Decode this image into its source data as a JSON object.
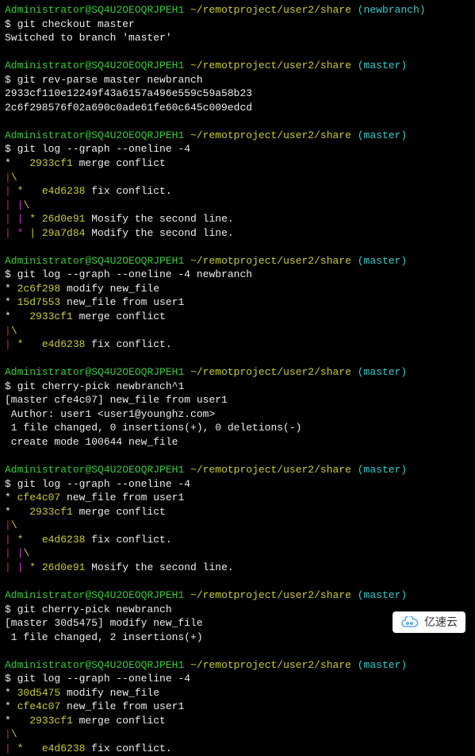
{
  "prompt": {
    "user": "Administrator",
    "host": "SQ4U2OEOQRJPEH1",
    "path": "~/remotproject/user2/share",
    "branch_new": "(newbranch)",
    "branch_master": "(master)"
  },
  "blocks": [
    {
      "branch": "(newbranch)",
      "cmd": "git checkout master",
      "out": [
        "Switched to branch 'master'"
      ]
    },
    {
      "branch": "(master)",
      "cmd": "git rev-parse master newbranch",
      "out": [
        "2933cf110e12249f43a6157a496e559c59a58b23",
        "2c6f298576f02a690c0ade61fe60c645c009edcd"
      ]
    }
  ],
  "log1": {
    "cmd": "git log --graph --oneline -4",
    "lines": [
      {
        "graph_w": "*   ",
        "graph_y": "",
        "hash": "2933cf1",
        "msg": " merge conflict"
      },
      {
        "graph_w": "",
        "graph_r": "|",
        "graph_y": "\\",
        "hash": "",
        "msg": ""
      },
      {
        "graph_w": "",
        "graph_r": "| ",
        "graph_y": "* ",
        "hash": "e4d6238",
        "msg": " fix conflict."
      },
      {
        "graph_w": "",
        "graph_r": "| ",
        "graph_m": "|",
        "graph_y": "\\",
        "hash": "",
        "msg": ""
      },
      {
        "graph_w": "",
        "graph_r": "| ",
        "graph_m": "| ",
        "graph_y": "* ",
        "hash": "26d0e91",
        "msg": " Mosify the second line."
      },
      {
        "graph_w": "",
        "graph_r": "| ",
        "graph_m": "* ",
        "graph_y2": "| ",
        "hash": "29a7d84",
        "msg": " Modify the second line."
      }
    ]
  },
  "log2": {
    "cmd": "git log --graph --oneline -4 newbranch",
    "lines": [
      {
        "g": "* ",
        "hash": "2c6f298",
        "msg": " modify new_file"
      },
      {
        "g": "* ",
        "hash": "15d7553",
        "msg": " new_file from user1"
      },
      {
        "g": "*   ",
        "hash": "2933cf1",
        "msg": " merge conflict"
      },
      {
        "gr": "|",
        "gy": "\\",
        "hash": "",
        "msg": ""
      },
      {
        "gr": "| ",
        "gy": "* ",
        "hash": "e4d6238",
        "msg": " fix conflict."
      }
    ]
  },
  "cherry1": {
    "cmd": "git cherry-pick newbranch^1",
    "out": [
      "[master cfe4c07] new_file from user1",
      " Author: user1 <user1@younghz.com>",
      " 1 file changed, 0 insertions(+), 0 deletions(-)",
      " create mode 100644 new_file"
    ]
  },
  "log3": {
    "cmd": "git log --graph --oneline -4",
    "lines": [
      {
        "g": "* ",
        "hash": "cfe4c07",
        "msg": " new_file from user1"
      },
      {
        "g": "*   ",
        "hash": "2933cf1",
        "msg": " merge conflict"
      },
      {
        "gr": "|",
        "gy": "\\",
        "hash": "",
        "msg": ""
      },
      {
        "gr": "| ",
        "gy": "* ",
        "hash": "e4d6238",
        "msg": " fix conflict."
      },
      {
        "gr": "| ",
        "gm": "|",
        "gy": "\\",
        "hash": "",
        "msg": ""
      },
      {
        "gr": "| ",
        "gm": "| ",
        "gy": "* ",
        "hash": "26d0e91",
        "msg": " Mosify the second line."
      }
    ]
  },
  "cherry2": {
    "cmd": "git cherry-pick newbranch",
    "out": [
      "[master 30d5475] modify new_file",
      " 1 file changed, 2 insertions(+)"
    ]
  },
  "log4": {
    "cmd": "git log --graph --oneline -4",
    "lines": [
      {
        "g": "* ",
        "hash": "30d5475",
        "msg": " modify new_file"
      },
      {
        "g": "* ",
        "hash": "cfe4c07",
        "msg": " new_file from user1"
      },
      {
        "g": "*   ",
        "hash": "2933cf1",
        "msg": " merge conflict"
      },
      {
        "gr": "|",
        "gy": "\\",
        "hash": "",
        "msg": ""
      },
      {
        "gr": "| ",
        "gy": "* ",
        "hash": "e4d6238",
        "msg": " fix conflict."
      }
    ]
  },
  "watermark": "亿速云"
}
